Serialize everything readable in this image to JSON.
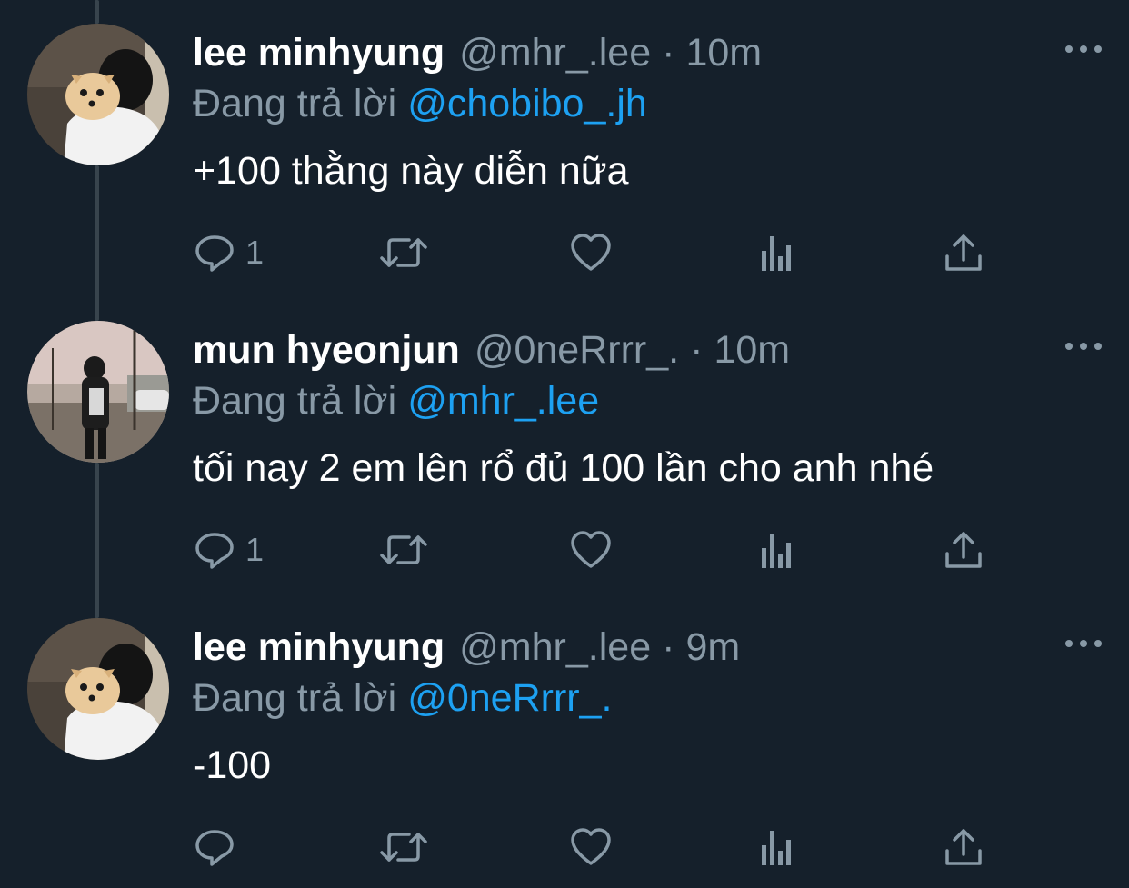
{
  "colors": {
    "background": "#15202b",
    "thread_line": "#38444d",
    "name": "#ffffff",
    "secondary": "#8899a6",
    "mention": "#1da1f2"
  },
  "tweets": [
    {
      "display_name": "lee minhyung",
      "handle": "@mhr_.lee",
      "separator": "·",
      "time": "10m",
      "reply_prefix": "Đang trả lời",
      "reply_to": "@chobibo_.jh",
      "text": "+100 thằng này diễn nữa",
      "reply_count": "1",
      "icons": [
        "reply-icon",
        "retweet-icon",
        "like-icon",
        "analytics-icon",
        "share-icon",
        "more-icon"
      ]
    },
    {
      "display_name": "mun hyeonjun",
      "handle": "@0neRrrr_.",
      "separator": "·",
      "time": "10m",
      "reply_prefix": "Đang trả lời",
      "reply_to": "@mhr_.lee",
      "text": "tối nay 2 em lên rổ đủ 100 lần cho anh nhé",
      "reply_count": "1",
      "icons": [
        "reply-icon",
        "retweet-icon",
        "like-icon",
        "analytics-icon",
        "share-icon",
        "more-icon"
      ]
    },
    {
      "display_name": "lee minhyung",
      "handle": "@mhr_.lee",
      "separator": "·",
      "time": "9m",
      "reply_prefix": "Đang trả lời",
      "reply_to": "@0neRrrr_.",
      "text": "-100",
      "reply_count": "",
      "icons": [
        "reply-icon",
        "retweet-icon",
        "like-icon",
        "analytics-icon",
        "share-icon",
        "more-icon"
      ]
    }
  ]
}
